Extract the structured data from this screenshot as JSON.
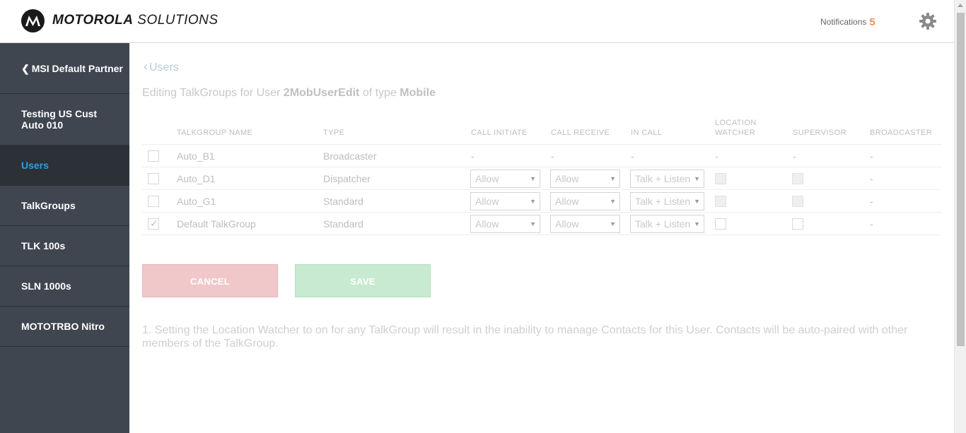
{
  "header": {
    "brand_bold": "MOTOROLA",
    "brand_light": "SOLUTIONS",
    "notifications_label": "Notifications",
    "notifications_count": "5"
  },
  "sidebar": {
    "items": [
      {
        "label": "MSI Default Partner",
        "back": true
      },
      {
        "label": "Testing US Cust Auto 010"
      },
      {
        "label": "Users",
        "active": true
      },
      {
        "label": "TalkGroups"
      },
      {
        "label": "TLK 100s"
      },
      {
        "label": "SLN 1000s"
      },
      {
        "label": "MOTOTRBO Nitro"
      }
    ]
  },
  "main": {
    "back_link": "Users",
    "heading": {
      "prefix": "Editing TalkGroups for User ",
      "user": "2MobUserEdit",
      "middle": " of type ",
      "type": "Mobile"
    },
    "columns": {
      "name": "TALKGROUP NAME",
      "type": "TYPE",
      "call_initiate": "CALL INITIATE",
      "call_receive": "CALL RECEIVE",
      "in_call": "IN CALL",
      "location_watcher_1": "LOCATION",
      "location_watcher_2": "WATCHER",
      "supervisor": "SUPERVISOR",
      "broadcaster": "BROADCASTER"
    },
    "rows": [
      {
        "checked": false,
        "name": "Auto_B1",
        "type": "Broadcaster",
        "call_initiate": "-",
        "call_receive": "-",
        "in_call": "-",
        "location_watcher": "-",
        "supervisor": "-",
        "broadcaster": "-"
      },
      {
        "checked": false,
        "name": "Auto_D1",
        "type": "Dispatcher",
        "call_initiate": "Allow",
        "call_receive": "Allow",
        "in_call": "Talk + Listen",
        "broadcaster": "-"
      },
      {
        "checked": false,
        "name": "Auto_G1",
        "type": "Standard",
        "call_initiate": "Allow",
        "call_receive": "Allow",
        "in_call": "Talk + Listen",
        "broadcaster": "-"
      },
      {
        "checked": true,
        "name": "Default TalkGroup",
        "type": "Standard",
        "call_initiate": "Allow",
        "call_receive": "Allow",
        "in_call": "Talk + Listen",
        "broadcaster": "-"
      }
    ],
    "cancel_label": "CANCEL",
    "save_label": "SAVE",
    "note": "1. Setting the Location Watcher to on for any TalkGroup will result in the inability to manage Contacts for this User. Contacts will be auto-paired with other members of the TalkGroup."
  },
  "colors": {
    "sidebar_bg": "#3f4650",
    "active_link": "#2f9fe0",
    "notification_count": "#f28c5c",
    "cancel_bg": "#f0c8ca",
    "save_bg": "#c8ead0"
  },
  "icons": {
    "logo": "motorola-batwing-icon",
    "settings": "gear-icon",
    "back": "chevron-left-icon",
    "dropdown": "caret-down-icon",
    "check": "checkmark-icon"
  }
}
